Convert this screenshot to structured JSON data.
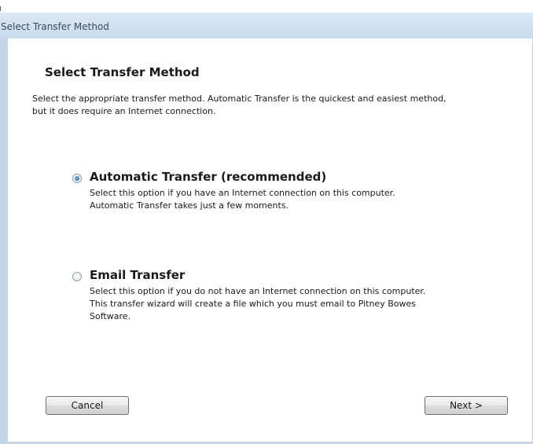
{
  "window": {
    "title": "Select Transfer Method"
  },
  "page": {
    "heading": "Select Transfer Method",
    "description_lines": [
      "Select the appropriate transfer method.  Automatic Transfer is the quickest and easiest method,",
      "but it does require an Internet connection."
    ]
  },
  "options": [
    {
      "label": "Automatic Transfer (recommended)",
      "selected": true,
      "description_lines": [
        "Select this option if you have an Internet connection on this computer.",
        "Automatic Transfer takes just a few moments."
      ]
    },
    {
      "label": "Email Transfer",
      "selected": false,
      "description_lines": [
        "Select this option if you do not have an Internet connection on this computer.",
        "This transfer wizard will create a file which you must email to Pitney Bowes",
        "Software."
      ]
    }
  ],
  "buttons": {
    "cancel_label": "Cancel",
    "next_label": "Next >"
  },
  "colors": {
    "titlebar": "#c9dbee",
    "selected_radio": "#1f5fa8"
  }
}
